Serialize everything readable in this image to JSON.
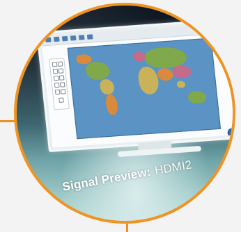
{
  "colors": {
    "accent_ring": "#ef9423",
    "screen_topbar_button": "#4f7fb1",
    "zoom_button": "#2b6ea8",
    "status_indicator": "#4bd16b"
  },
  "icons": {
    "map": "world-map-icon",
    "zoom": "zoom-button-icon",
    "status": "status-dot-icon"
  },
  "caption": {
    "label": "Signal Preview:",
    "value": "HDMI2"
  }
}
